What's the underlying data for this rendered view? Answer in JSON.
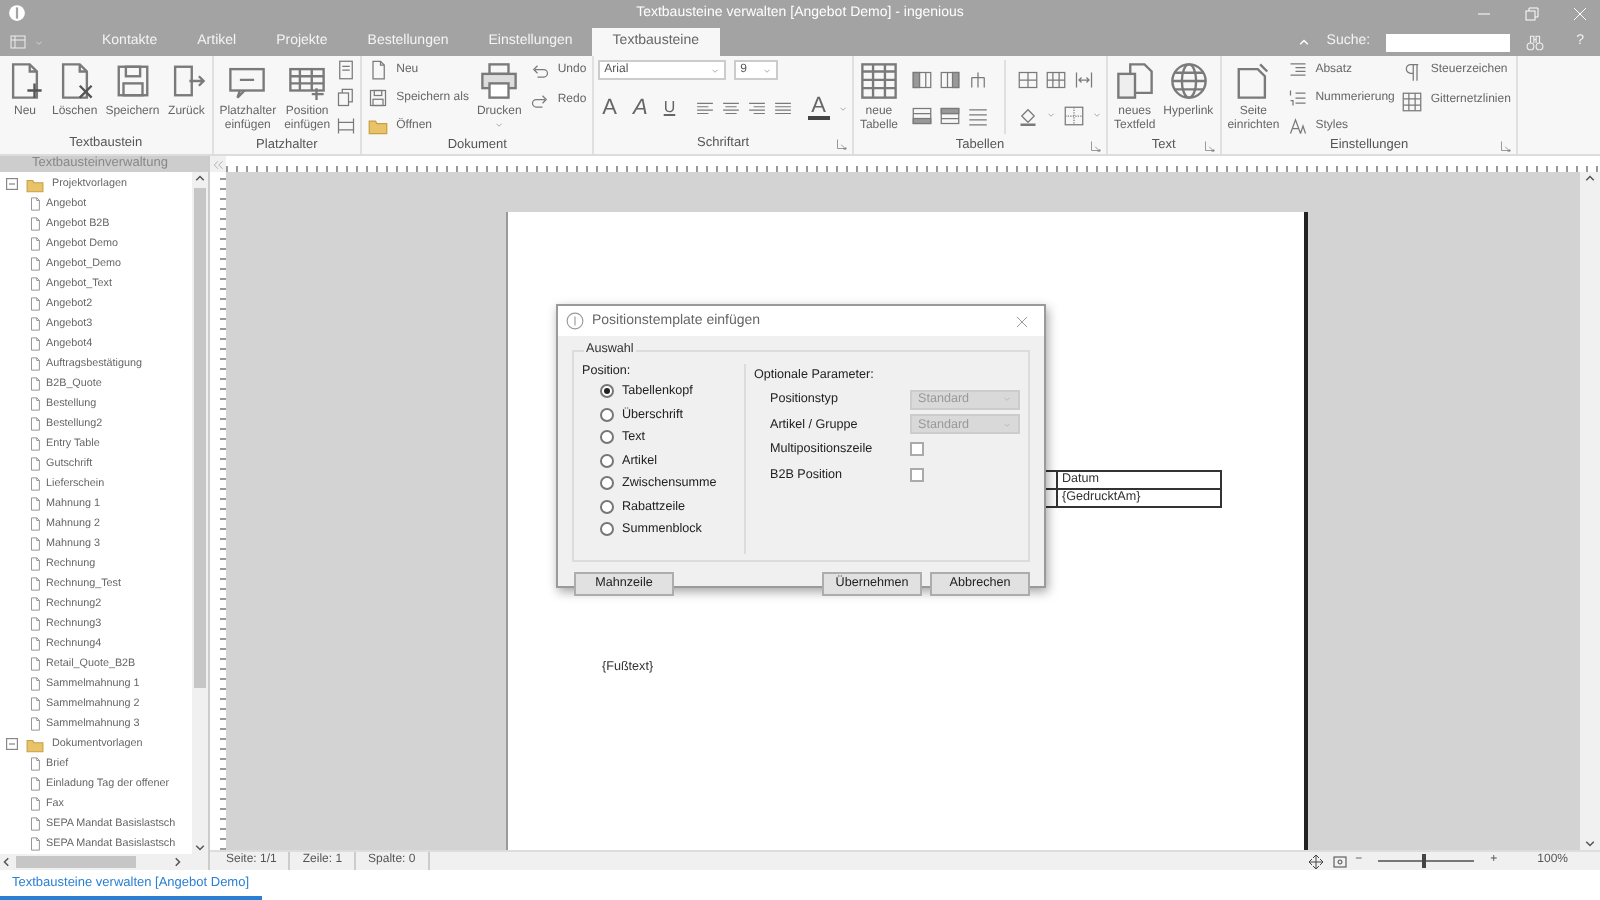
{
  "window": {
    "title": "Textbausteine verwalten [Angebot Demo] - ingenious"
  },
  "menu_tabs": [
    {
      "label": "Kontakte",
      "selected": false
    },
    {
      "label": "Artikel",
      "selected": false
    },
    {
      "label": "Projekte",
      "selected": false
    },
    {
      "label": "Bestellungen",
      "selected": false
    },
    {
      "label": "Einstellungen",
      "selected": false
    },
    {
      "label": "Textbausteine",
      "selected": true
    }
  ],
  "search": {
    "label": "Suche:",
    "help": "?"
  },
  "ribbon": [
    {
      "title": "Textbaustein",
      "launcher": false,
      "items": [
        {
          "label": "Neu",
          "kind": "large"
        },
        {
          "label": "Löschen",
          "kind": "large"
        },
        {
          "label": "Speichern",
          "kind": "large"
        },
        {
          "label": "Zurück",
          "kind": "large"
        }
      ]
    },
    {
      "title": "Platzhalter",
      "launcher": false,
      "items": [
        {
          "label": "Platzhalter einfügen",
          "kind": "large"
        },
        {
          "label": "Position einfügen",
          "kind": "large"
        }
      ]
    },
    {
      "title": "Dokument",
      "launcher": false,
      "items": [
        {
          "label": "Neu",
          "kind": "small"
        },
        {
          "label": "Speichern als",
          "kind": "small"
        },
        {
          "label": "Öffnen",
          "kind": "small"
        },
        {
          "label": "Drucken",
          "kind": "large"
        },
        {
          "label": "Undo",
          "kind": "small"
        },
        {
          "label": "Redo",
          "kind": "small"
        }
      ]
    },
    {
      "title": "Schriftart",
      "launcher": true,
      "font": "Arial",
      "size": "9",
      "glyphs": [
        "A",
        "A",
        "U"
      ],
      "color_glyph": "A"
    },
    {
      "title": "Tabellen",
      "launcher": true,
      "items": [
        {
          "label": "neue Tabelle",
          "kind": "large"
        }
      ]
    },
    {
      "title": "Text",
      "launcher": true,
      "items": [
        {
          "label": "neues Textfeld",
          "kind": "large"
        },
        {
          "label": "Hyperlink",
          "kind": "large"
        }
      ]
    },
    {
      "title": "Einstellungen",
      "launcher": true,
      "items": [
        {
          "label": "Seite einrichten",
          "kind": "large"
        },
        {
          "label": "Absatz",
          "kind": "small"
        },
        {
          "label": "Nummerierung",
          "kind": "small"
        },
        {
          "label": "Styles",
          "kind": "small"
        },
        {
          "label": "Steuerzeichen",
          "kind": "small"
        },
        {
          "label": "Gitternetzlinien",
          "kind": "small"
        }
      ]
    }
  ],
  "sidebar": {
    "title": "Textbausteinverwaltung",
    "tree": [
      {
        "label": "Projektvorlagen",
        "expanded": true,
        "children": [
          {
            "label": "Angebot"
          },
          {
            "label": "Angebot B2B"
          },
          {
            "label": "Angebot Demo"
          },
          {
            "label": "Angebot_Demo"
          },
          {
            "label": "Angebot_Text"
          },
          {
            "label": "Angebot2"
          },
          {
            "label": "Angebot3"
          },
          {
            "label": "Angebot4"
          },
          {
            "label": "Auftragsbestätigung"
          },
          {
            "label": "B2B_Quote"
          },
          {
            "label": "Bestellung"
          },
          {
            "label": "Bestellung2"
          },
          {
            "label": "Entry Table"
          },
          {
            "label": "Gutschrift"
          },
          {
            "label": "Lieferschein"
          },
          {
            "label": "Mahnung 1"
          },
          {
            "label": "Mahnung 2"
          },
          {
            "label": "Mahnung 3"
          },
          {
            "label": "Rechnung"
          },
          {
            "label": "Rechnung_Test"
          },
          {
            "label": "Rechnung2"
          },
          {
            "label": "Rechnung3"
          },
          {
            "label": "Rechnung4"
          },
          {
            "label": "Retail_Quote_B2B"
          },
          {
            "label": "Sammelmahnung 1"
          },
          {
            "label": "Sammelmahnung 2"
          },
          {
            "label": "Sammelmahnung 3"
          }
        ]
      },
      {
        "label": "Dokumentvorlagen",
        "expanded": true,
        "children": [
          {
            "label": "Brief"
          },
          {
            "label": "Einladung Tag der offener"
          },
          {
            "label": "Fax"
          },
          {
            "label": "SEPA Mandat Basislastsch"
          },
          {
            "label": "SEPA Mandat Basislastsch"
          }
        ]
      }
    ]
  },
  "document": {
    "table_header": "Datum",
    "table_value": "{GedrucktAm}",
    "footer": "{Fußtext}"
  },
  "dialog": {
    "title": "Positionstemplate einfügen",
    "group_title": "Auswahl",
    "position_label": "Position:",
    "options": [
      {
        "label": "Tabellenkopf",
        "selected": true
      },
      {
        "label": "Überschrift",
        "selected": false
      },
      {
        "label": "Text",
        "selected": false
      },
      {
        "label": "Artikel",
        "selected": false
      },
      {
        "label": "Zwischensumme",
        "selected": false
      },
      {
        "label": "Rabattzeile",
        "selected": false
      },
      {
        "label": "Summenblock",
        "selected": false
      }
    ],
    "params_title": "Optionale Parameter:",
    "params": [
      {
        "label": "Positionstyp",
        "kind": "select",
        "value": "Standard",
        "disabled": true
      },
      {
        "label": "Artikel / Gruppe",
        "kind": "select",
        "value": "Standard",
        "disabled": true
      },
      {
        "label": "Multipositionszeile",
        "kind": "checkbox",
        "checked": false
      },
      {
        "label": "B2B Position",
        "kind": "checkbox",
        "checked": false
      }
    ],
    "buttons": [
      {
        "label": "Mahnzeile"
      },
      {
        "label": "Übernehmen"
      },
      {
        "label": "Abbrechen"
      }
    ]
  },
  "status_bar": {
    "fields": [
      "Seite: 1/1",
      "Zeile: 1",
      "Spalte: 0"
    ],
    "zoom_minus": "−",
    "zoom_plus": "+",
    "zoom": {
      "level": 0.45
    },
    "zoom_label": "100%"
  },
  "document_tabs": [
    {
      "label": "Textbausteine verwalten [Angebot Demo]",
      "selected": true
    }
  ]
}
